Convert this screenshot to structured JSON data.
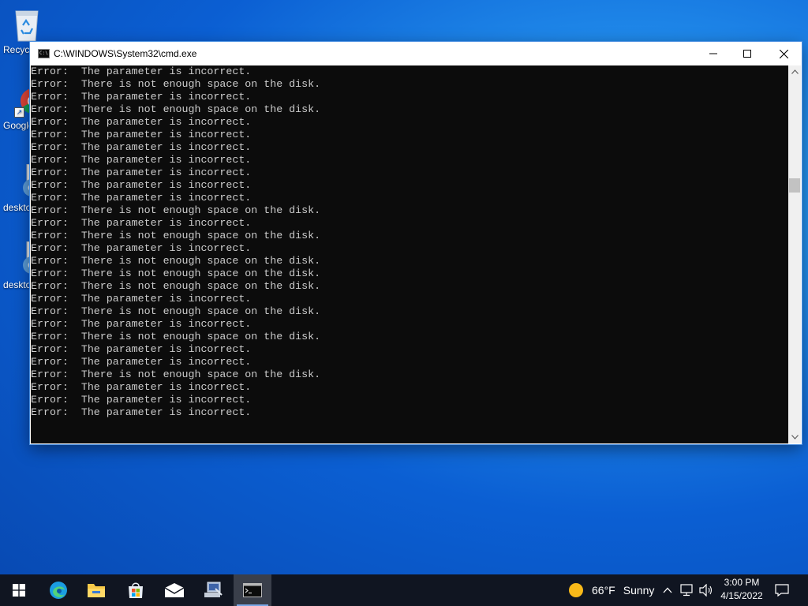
{
  "desktop": {
    "icons": [
      {
        "label": "Recycle Bin"
      },
      {
        "label": "Google Chrome"
      },
      {
        "label": "desktop.ini"
      },
      {
        "label": "desktop.ini"
      }
    ]
  },
  "window": {
    "title": "C:\\WINDOWS\\System32\\cmd.exe",
    "buttons": {
      "minimize": "—",
      "maximize": "☐",
      "close": "✕"
    }
  },
  "console": {
    "lines": [
      "Error:  The parameter is incorrect.",
      "Error:  There is not enough space on the disk.",
      "Error:  The parameter is incorrect.",
      "Error:  There is not enough space on the disk.",
      "Error:  The parameter is incorrect.",
      "Error:  The parameter is incorrect.",
      "Error:  The parameter is incorrect.",
      "Error:  The parameter is incorrect.",
      "Error:  The parameter is incorrect.",
      "Error:  The parameter is incorrect.",
      "Error:  The parameter is incorrect.",
      "Error:  There is not enough space on the disk.",
      "Error:  The parameter is incorrect.",
      "Error:  There is not enough space on the disk.",
      "Error:  The parameter is incorrect.",
      "Error:  There is not enough space on the disk.",
      "Error:  There is not enough space on the disk.",
      "Error:  There is not enough space on the disk.",
      "Error:  The parameter is incorrect.",
      "Error:  There is not enough space on the disk.",
      "Error:  The parameter is incorrect.",
      "Error:  There is not enough space on the disk.",
      "Error:  The parameter is incorrect.",
      "Error:  The parameter is incorrect.",
      "Error:  There is not enough space on the disk.",
      "Error:  The parameter is incorrect.",
      "Error:  The parameter is incorrect.",
      "Error:  The parameter is incorrect."
    ]
  },
  "taskbar": {
    "apps": [
      "start-icon",
      "edge-icon",
      "file-explorer-icon",
      "store-icon",
      "mail-icon",
      "network-app-icon",
      "command-prompt-icon"
    ],
    "weather": {
      "temp": "66°F",
      "condition": "Sunny"
    },
    "clock": {
      "time": "3:00 PM",
      "date": "4/15/2022"
    }
  },
  "colors": {
    "console_bg": "#0c0c0c",
    "console_text": "#cccccc",
    "taskbar_bg": "#101521"
  }
}
